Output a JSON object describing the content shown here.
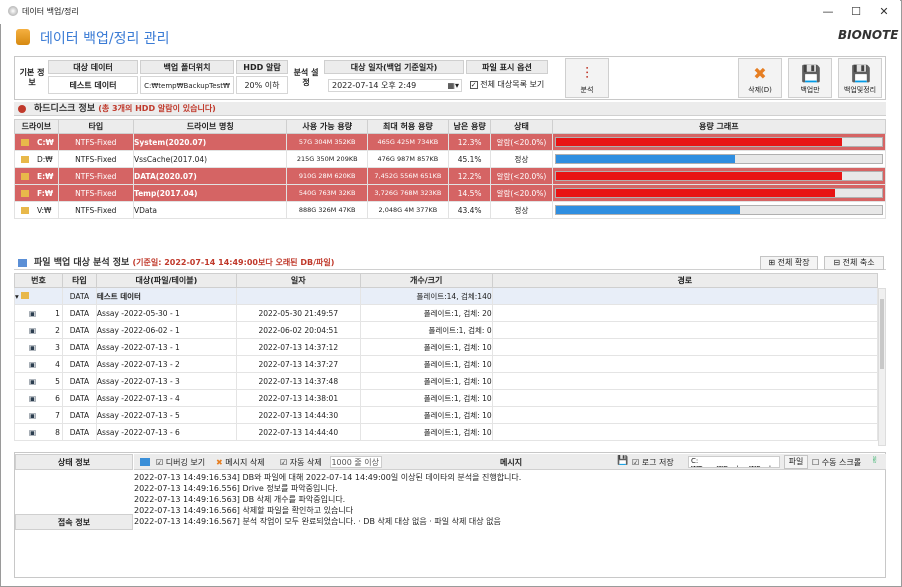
{
  "window": {
    "title": "데이터 백업/정리",
    "app_title": "데이터 백업/정리 관리",
    "brand": "BIONOTE"
  },
  "top": {
    "basic_label": "기본 정보",
    "target_hdr": "대상 데이터",
    "target_val": "테스트 데이터",
    "root_hdr": "백업 폴더위치",
    "root_val": "C:₩temp₩BackupTest₩",
    "hdd_hdr": "HDD 알람",
    "hdd_val": "20% 이하",
    "analysis_label": "분석 설정",
    "date_hdr": "대상 일자(백업 기준일자)",
    "date_val": "2022-07-14 오후  2:49",
    "option_hdr": "파일 표시 옵션",
    "option_val": "전체 대상목록 보기",
    "btn_analyze": "분석",
    "btn_delete": "삭제(D)",
    "btn_backup": "백업만",
    "btn_backup_clean": "백업및정리"
  },
  "hdd": {
    "title": "하드디스크 정보",
    "note": "(총 3개의 HDD 알람이 있습니다)",
    "headers": [
      "드라이브",
      "타입",
      "드라이브 명칭",
      "사용 가능 용량",
      "최대 허용 용량",
      "남은 용량",
      "상태",
      "용량 그래프"
    ],
    "rows": [
      {
        "drive": "C:₩",
        "type": "NTFS-Fixed",
        "name": "System(2020.07)",
        "free": "57G 304M 352KB",
        "max": "465G 425M 734KB",
        "left": "12.3%",
        "status": "알람(<20.0%)",
        "alarm": true,
        "used": 0.877
      },
      {
        "drive": "D:₩",
        "type": "NTFS-Fixed",
        "name": "VssCache(2017.04)",
        "free": "215G 350M 209KB",
        "max": "476G 987M 857KB",
        "left": "45.1%",
        "status": "정상",
        "alarm": false,
        "used": 0.549
      },
      {
        "drive": "E:₩",
        "type": "NTFS-Fixed",
        "name": "DATA(2020.07)",
        "free": "910G 28M 620KB",
        "max": "7,452G 556M 651KB",
        "left": "12.2%",
        "status": "알람(<20.0%)",
        "alarm": true,
        "used": 0.878
      },
      {
        "drive": "F:₩",
        "type": "NTFS-Fixed",
        "name": "Temp(2017.04)",
        "free": "540G 763M 32KB",
        "max": "3,726G 768M 323KB",
        "left": "14.5%",
        "status": "알람(<20.0%)",
        "alarm": true,
        "used": 0.855
      },
      {
        "drive": "V:₩",
        "type": "NTFS-Fixed",
        "name": "VData",
        "free": "888G 326M 47KB",
        "max": "2,048G 4M 377KB",
        "left": "43.4%",
        "status": "정상",
        "alarm": false,
        "used": 0.566
      }
    ]
  },
  "files": {
    "title": "파일 백업 대상 분석 정보",
    "note": "(기준일: 2022-07-14 14:49:00보다 오래된 DB/파일)",
    "btn_expand": "전체 확장",
    "btn_collapse": "전체 축소",
    "headers": [
      "번호",
      "타입",
      "대상(파일/테이블)",
      "일자",
      "개수/크기",
      "경로"
    ],
    "group": {
      "type": "DATA",
      "name": "테스트 데이터",
      "count": "폴레이트:14, 검체:140"
    },
    "rows": [
      {
        "no": "1",
        "type": "DATA",
        "name": "Assay -2022-05-30 - 1",
        "date": "2022-05-30 21:49:57",
        "count": "폴레이트:1, 검체: 20"
      },
      {
        "no": "2",
        "type": "DATA",
        "name": "Assay -2022-06-02 - 1",
        "date": "2022-06-02 20:04:51",
        "count": "폴레이트:1, 검체: 0"
      },
      {
        "no": "3",
        "type": "DATA",
        "name": "Assay -2022-07-13 - 1",
        "date": "2022-07-13 14:37:12",
        "count": "폴레이트:1, 검체: 10"
      },
      {
        "no": "4",
        "type": "DATA",
        "name": "Assay -2022-07-13 - 2",
        "date": "2022-07-13 14:37:27",
        "count": "폴레이트:1, 검체: 10"
      },
      {
        "no": "5",
        "type": "DATA",
        "name": "Assay -2022-07-13 - 3",
        "date": "2022-07-13 14:37:48",
        "count": "폴레이트:1, 검체: 10"
      },
      {
        "no": "6",
        "type": "DATA",
        "name": "Assay -2022-07-13 - 4",
        "date": "2022-07-13 14:38:01",
        "count": "폴레이트:1, 검체: 10"
      },
      {
        "no": "7",
        "type": "DATA",
        "name": "Assay -2022-07-13 - 5",
        "date": "2022-07-13 14:44:30",
        "count": "폴레이트:1, 검체: 10"
      },
      {
        "no": "8",
        "type": "DATA",
        "name": "Assay -2022-07-13 - 6",
        "date": "2022-07-13 14:44:40",
        "count": "폴레이트:1, 검체: 10"
      }
    ]
  },
  "bottom": {
    "status_label": "상태 정보",
    "conn_label": "접속 정보",
    "debug": "디버깅 보기",
    "del_msg": "메시지 삭제",
    "auto_del": "자동 삭제",
    "limit": "1000 줄 이상",
    "msg_label": "메시지",
    "log_save": "로그 저장",
    "log_path": "C:₩Temp₩Backup₩Backu",
    "file_btn": "파일",
    "manual_scroll": "수동 스크롤",
    "logs": [
      "2022-07-13 14:49:16.534] DB와 파일에 대해 2022-07-14 14:49:00일 이상된 데이타의 분석을 진행합니다.",
      "2022-07-13 14:49:16.556] Drive 정보를 파악중입니다.",
      "2022-07-13 14:49:16.563] DB 삭제 개수를 파악중입니다.",
      "2022-07-13 14:49:16.566] 삭제할 파일을 확인하고 있습니다",
      "2022-07-13 14:49:16.567] 분석 작업이 모두 완료되었습니다. · DB 삭제 대상 없음 · 파일 삭제 대상 없음"
    ]
  }
}
